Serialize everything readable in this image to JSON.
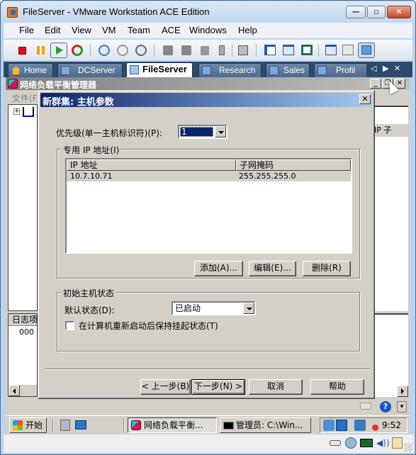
{
  "window": {
    "title": "FileServer - VMware Workstation ACE Edition",
    "controls": {
      "minimize": "—",
      "maximize": "▫",
      "close": "✕"
    }
  },
  "menubar": {
    "items": [
      {
        "label": "File"
      },
      {
        "label": "Edit"
      },
      {
        "label": "View"
      },
      {
        "label": "VM"
      },
      {
        "label": "Team"
      },
      {
        "label": "ACE"
      },
      {
        "label": "Windows"
      },
      {
        "label": "Help"
      }
    ]
  },
  "toolbar": {
    "buttons": [
      {
        "name": "power-off",
        "icon": "stop-icon"
      },
      {
        "name": "suspend",
        "icon": "pause-icon"
      },
      {
        "name": "power-on",
        "icon": "play-icon",
        "active": true
      },
      {
        "name": "reset",
        "icon": "reset-icon"
      },
      {
        "name": "take-snapshot",
        "icon": "snapshot-take-icon"
      },
      {
        "name": "revert-snapshot",
        "icon": "snapshot-revert-icon"
      },
      {
        "name": "snapshot-manager",
        "icon": "snapshot-manager-icon"
      },
      {
        "name": "team-power-on",
        "icon": "team-icon"
      },
      {
        "name": "team-power-off",
        "icon": "team-icon"
      },
      {
        "name": "add-vm",
        "icon": "add-vm-icon"
      },
      {
        "name": "add-usb",
        "icon": "usb-icon"
      },
      {
        "name": "capture",
        "icon": "capture-icon"
      },
      {
        "name": "show-sidebar",
        "icon": "sidebar-icon"
      },
      {
        "name": "full-screen",
        "icon": "fullscreen-icon"
      },
      {
        "name": "quick-switch",
        "icon": "quickswitch-icon"
      },
      {
        "name": "summary",
        "icon": "summary-icon"
      },
      {
        "name": "console",
        "icon": "console-icon"
      },
      {
        "name": "appliance-view",
        "icon": "appliance-icon",
        "active": true
      }
    ]
  },
  "tabs": {
    "items": [
      {
        "label": "Home",
        "icon": "home-icon"
      },
      {
        "label": "DCServer",
        "icon": "vm-icon"
      },
      {
        "label": "FileServer",
        "icon": "vm-running-icon",
        "active": true
      },
      {
        "label": "Research",
        "icon": "vm-icon"
      },
      {
        "label": "Sales",
        "icon": "team-icon"
      },
      {
        "label": "Profil",
        "icon": "team-icon"
      }
    ],
    "nav": {
      "prev": "◁",
      "next": "▶",
      "close": "✕"
    }
  },
  "guest": {
    "nlb_window": {
      "title": "网络负载平衡管理器",
      "menu_first": "文件(F",
      "right_pane_header": "IP 子",
      "log_header": "日志项",
      "log_row": "000",
      "controls": {
        "minimize": "_",
        "restore": "❐",
        "close": "✕"
      }
    },
    "dialog": {
      "title": "新群集:   主机参数",
      "close": "✕",
      "priority_label": "优先级(单一主机标识符)(P):",
      "priority_value": "1",
      "dedicated_ip_group": "专用 IP 地址(I)",
      "ip_table": {
        "columns": [
          "IP 地址",
          "子网掩码"
        ],
        "rows": [
          {
            "ip": "10.7.10.71",
            "mask": "255.255.255.0"
          }
        ]
      },
      "buttons": {
        "add": "添加(A)...",
        "edit": "编辑(E)...",
        "remove": "删除(R)",
        "back": "< 上一步(B)",
        "next": "下一步(N) >",
        "cancel": "取消",
        "help": "帮助"
      },
      "initial_state_group": "初始主机状态",
      "default_state_label": "默认状态(D):",
      "default_state_value": "已启动",
      "retain_suspended_label": "在计算机重新启动后保持挂起状态(T)",
      "retain_suspended_checked": false
    },
    "taskbar": {
      "start": "开始",
      "tasks": [
        {
          "label": "网络负载平衡...",
          "active": true
        },
        {
          "label": "管理员: C:\\Win..."
        }
      ],
      "clock": "9:52"
    }
  },
  "vm_status": {
    "devices": [
      "hard-disk-icon",
      "cdrom-disconnected-icon",
      "network-icon",
      "sound-icon",
      "message-icon"
    ]
  }
}
